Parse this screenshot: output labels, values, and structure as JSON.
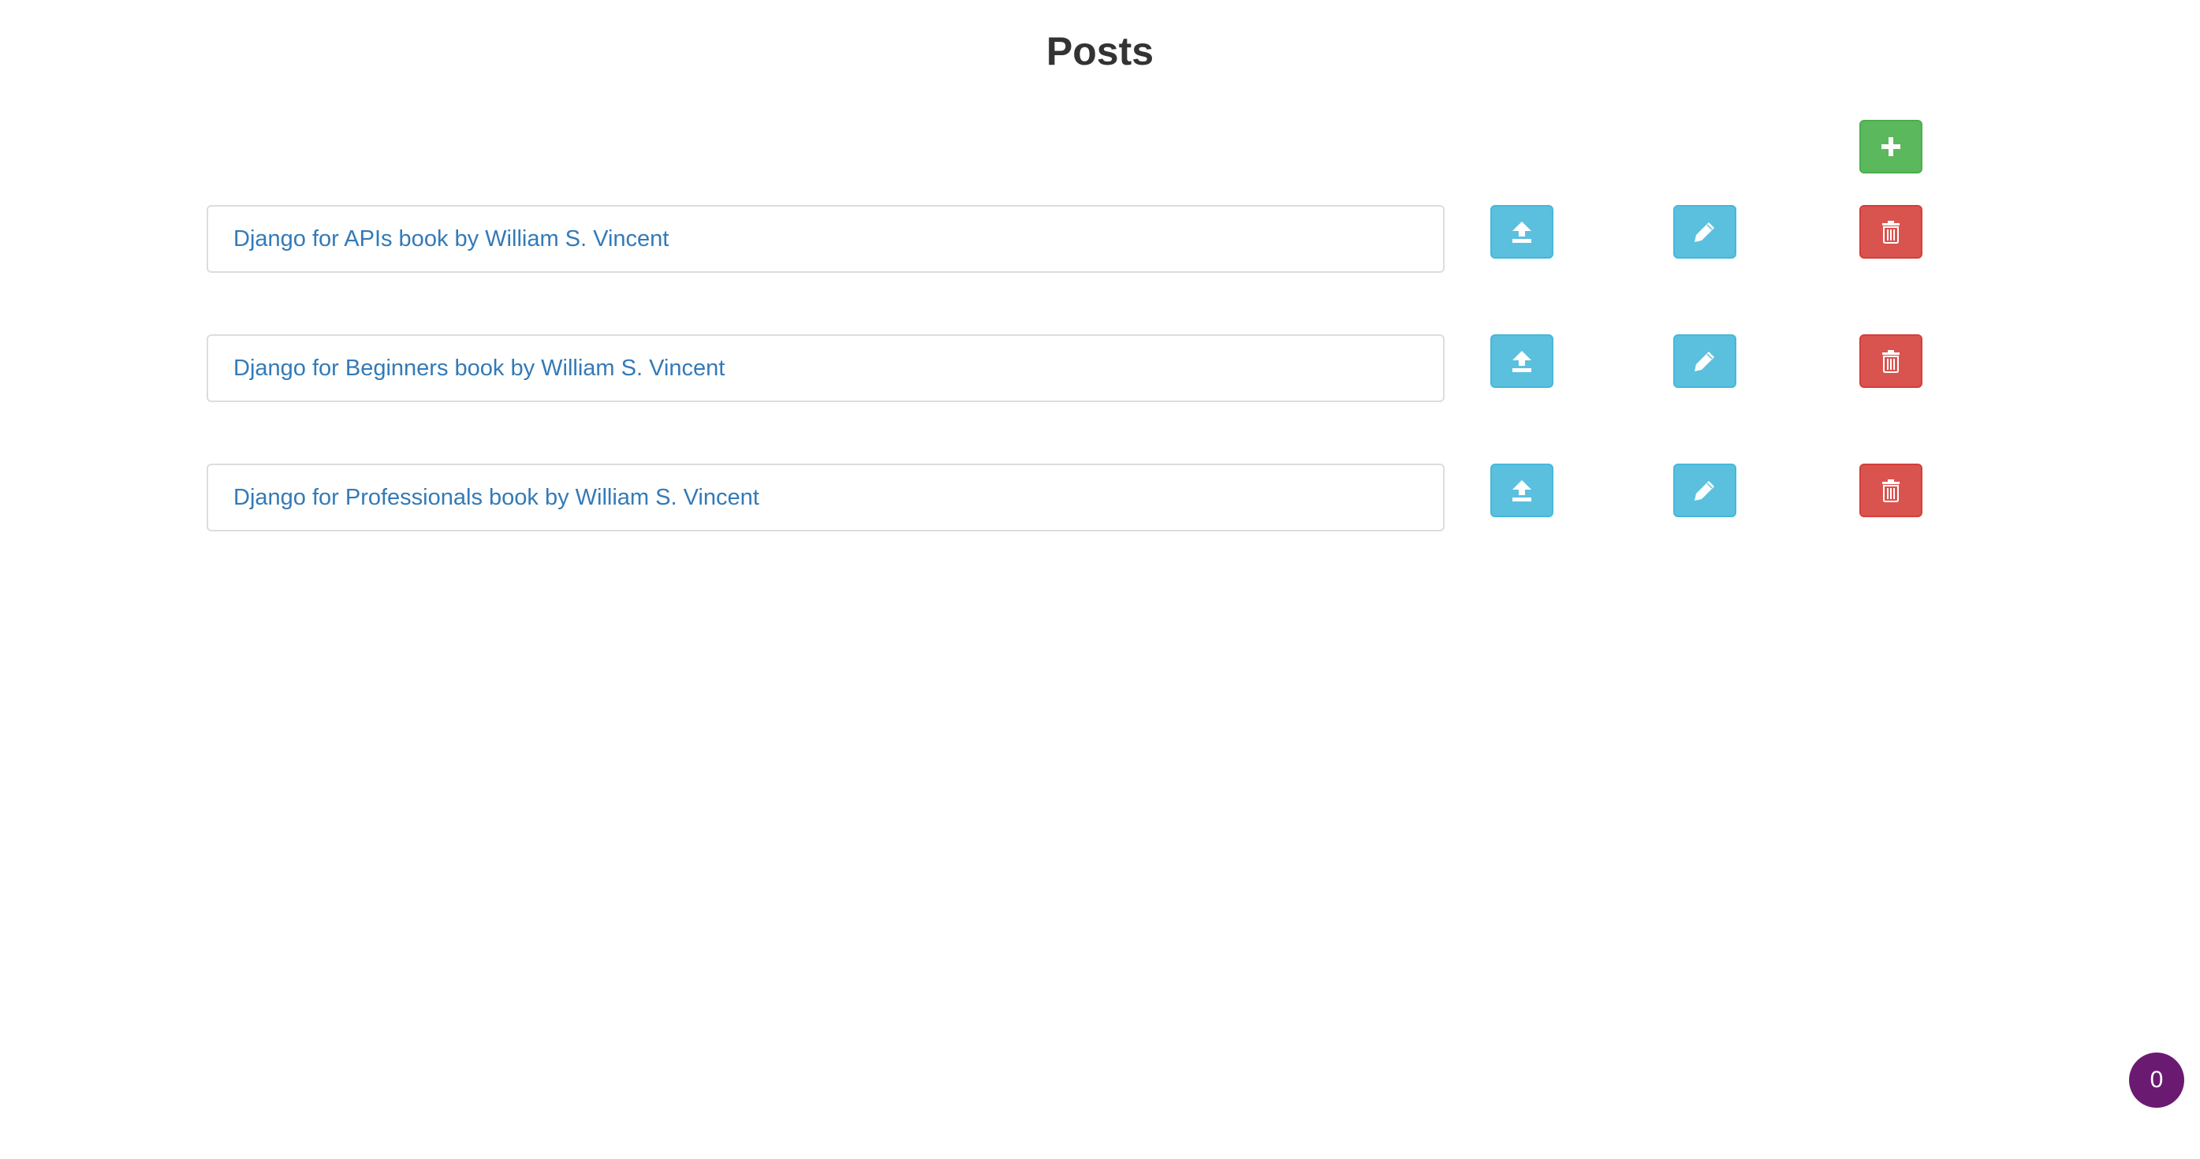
{
  "page": {
    "title": "Posts"
  },
  "toolbar": {
    "add_icon": "plus-icon"
  },
  "posts": [
    {
      "title": "Django for APIs book by William S. Vincent",
      "publish_icon": "upload-icon",
      "edit_icon": "pencil-icon",
      "delete_icon": "trash-icon"
    },
    {
      "title": "Django for Beginners book by William S. Vincent",
      "publish_icon": "upload-icon",
      "edit_icon": "pencil-icon",
      "delete_icon": "trash-icon"
    },
    {
      "title": "Django for Professionals book by William S. Vincent",
      "publish_icon": "upload-icon",
      "edit_icon": "pencil-icon",
      "delete_icon": "trash-icon"
    }
  ],
  "notification": {
    "count": "0"
  },
  "colors": {
    "success": "#5cb85c",
    "info": "#5bc0de",
    "danger": "#d9534f",
    "link": "#337ab7",
    "badge": "#6b1a72"
  }
}
